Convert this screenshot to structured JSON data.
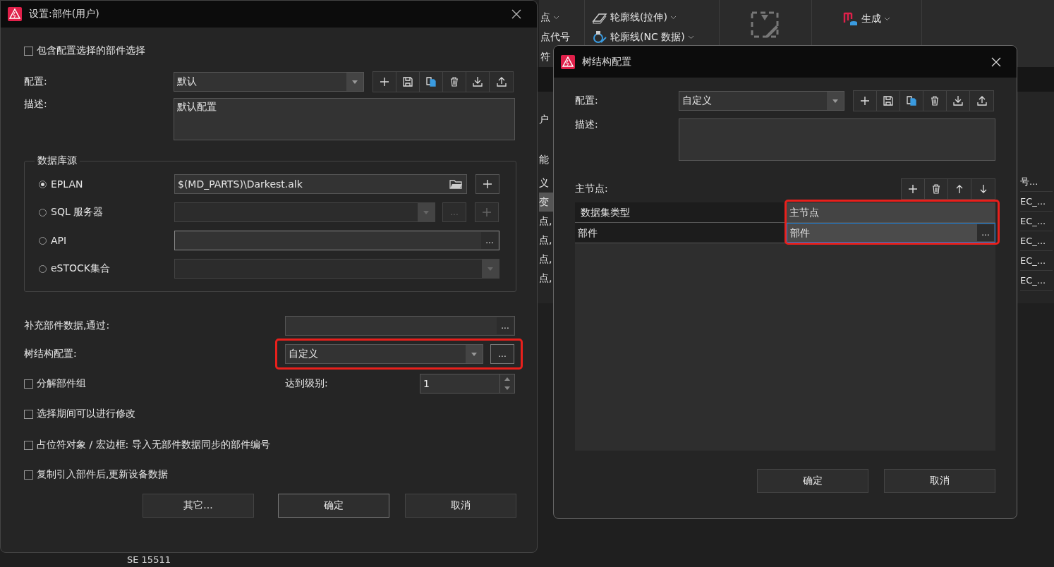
{
  "background": {
    "ribbon": [
      {
        "label": "点",
        "caret": true
      },
      {
        "label": "点代号",
        "caret": false
      },
      {
        "label": "符",
        "caret": false
      },
      {
        "label": "轮廓线(拉伸)",
        "caret": true
      },
      {
        "label": "轮廓线(NC 数据)",
        "caret": true
      },
      {
        "label": "生成",
        "caret": true
      }
    ],
    "left_fragments": [
      {
        "text": "户",
        "selected": false
      },
      {
        "text": "能",
        "selected": false
      },
      {
        "text": "义",
        "selected": false
      },
      {
        "text": "变",
        "selected": true
      },
      {
        "text": "点,",
        "selected": false
      },
      {
        "text": "点,",
        "selected": false
      },
      {
        "text": "点,",
        "selected": false
      },
      {
        "text": "点,",
        "selected": false
      }
    ],
    "right_fragments": [
      "号...",
      "EC_...",
      "EC_...",
      "EC_...",
      "EC_...",
      "EC_..."
    ],
    "tree_item": "SE 15511"
  },
  "settings_dialog": {
    "title": "设置:部件(用户)",
    "include_checkbox": {
      "label": "包含配置选择的部件选择",
      "checked": false
    },
    "config": {
      "label": "配置:",
      "value": "默认"
    },
    "description": {
      "label": "描述:",
      "value": "默认配置"
    },
    "database_source": {
      "title": "数据库源",
      "options": [
        {
          "label": "EPLAN",
          "selected": true,
          "kind": "path",
          "value": "$(MD_PARTS)\\Darkest.alk"
        },
        {
          "label": "SQL 服务器",
          "selected": false,
          "kind": "combo",
          "disabled": true,
          "browse": "..."
        },
        {
          "label": "API",
          "selected": false,
          "kind": "input",
          "browse": "..."
        },
        {
          "label": "eSTOCK集合",
          "selected": false,
          "kind": "combo",
          "disabled": true
        }
      ]
    },
    "supplement": {
      "label": "补充部件数据,通过:",
      "browse": "..."
    },
    "tree_config": {
      "label": "树结构配置:",
      "value": "自定义",
      "browse": "...",
      "highlighted": true
    },
    "split_checkbox": {
      "label": "分解部件组",
      "checked": false
    },
    "level": {
      "label": "达到级别:",
      "value": "1"
    },
    "checkboxes": [
      {
        "label": "选择期间可以进行修改",
        "checked": false
      },
      {
        "label": "占位符对象 / 宏边框: 导入无部件数据同步的部件编号",
        "checked": false
      },
      {
        "label": "复制引入部件后,更新设备数据",
        "checked": false
      }
    ],
    "buttons": [
      {
        "label": "其它...",
        "focused": false
      },
      {
        "label": "确定",
        "focused": true
      },
      {
        "label": "取消",
        "focused": false
      }
    ]
  },
  "tree_dialog": {
    "title": "树结构配置",
    "config": {
      "label": "配置:",
      "value": "自定义"
    },
    "description": {
      "label": "描述:"
    },
    "main_nodes": {
      "label": "主节点:",
      "rows": [
        {
          "type": "数据集类型",
          "node": "主节点",
          "selected": false
        },
        {
          "type": "部件",
          "node": "部件",
          "selected": true,
          "browse": "..."
        }
      ],
      "highlighted": true
    },
    "buttons": [
      {
        "label": "确定"
      },
      {
        "label": "取消"
      }
    ]
  }
}
